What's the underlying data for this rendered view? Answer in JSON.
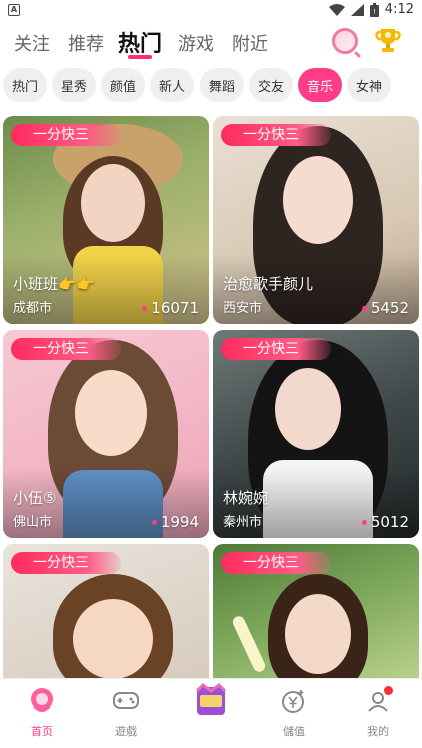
{
  "status_bar": {
    "time": "4:12"
  },
  "top_nav": {
    "tabs": [
      "关注",
      "推荐",
      "热门",
      "游戏",
      "附近"
    ],
    "active_index": 2
  },
  "chips": {
    "items": [
      "热门",
      "星秀",
      "颜值",
      "新人",
      "舞蹈",
      "交友",
      "音乐",
      "女神"
    ],
    "active_index": 6
  },
  "cards": [
    {
      "badge": "一分快三",
      "name": "小班班👉👉",
      "city": "成都市",
      "likes": "16071"
    },
    {
      "badge": "一分快三",
      "name": "治愈歌手颜儿",
      "city": "西安市",
      "likes": "5452"
    },
    {
      "badge": "一分快三",
      "name": "小伍⑤",
      "city": "佛山市",
      "likes": "1994"
    },
    {
      "badge": "一分快三",
      "name": "林婉婉",
      "city": "秦州市",
      "likes": "5012"
    },
    {
      "badge": "一分快三",
      "name": "",
      "city": "",
      "likes": ""
    },
    {
      "badge": "一分快三",
      "name": "",
      "city": "",
      "likes": ""
    }
  ],
  "bottom_nav": {
    "items": [
      {
        "label": "首页",
        "icon": "home-avatar-icon"
      },
      {
        "label": "遊戲",
        "icon": "gamepad-icon"
      },
      {
        "label": "",
        "icon": "center-promo-icon"
      },
      {
        "label": "儲值",
        "icon": "yuan-coin-icon"
      },
      {
        "label": "我的",
        "icon": "profile-icon"
      }
    ],
    "active_index": 0
  },
  "colors": {
    "accent": "#ff3d86",
    "badge": "#ff2b5e"
  }
}
